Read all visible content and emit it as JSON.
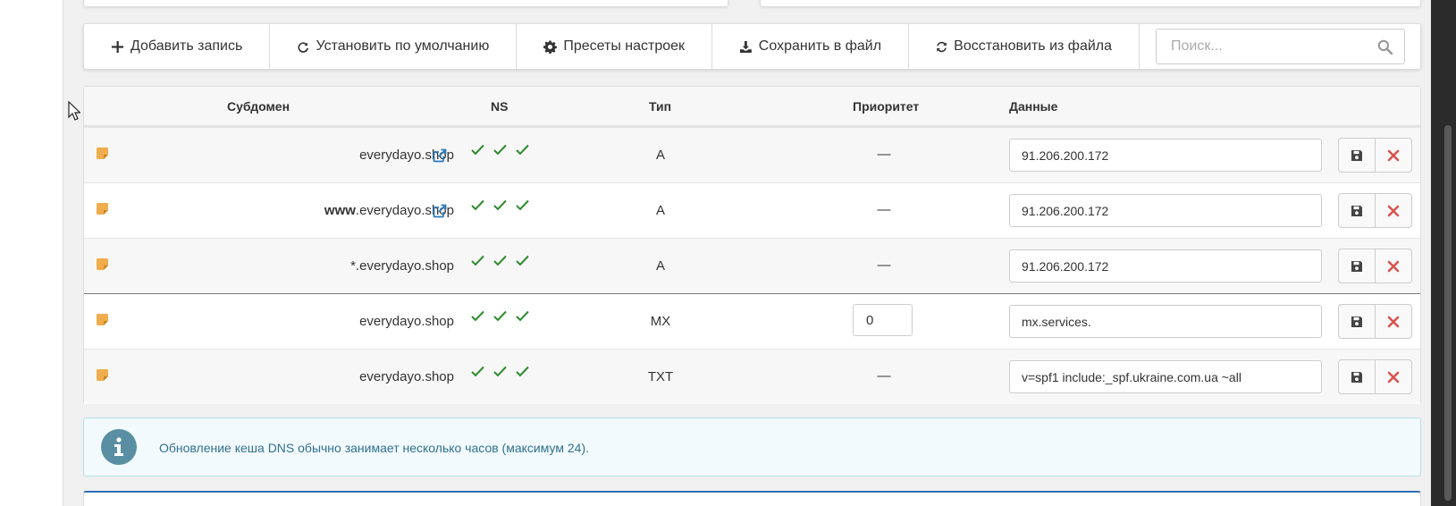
{
  "toolbar": {
    "add_label": "Добавить запись",
    "reset_label": "Установить по умолчанию",
    "presets_label": "Пресеты настроек",
    "save_file_label": "Сохранить в файл",
    "restore_file_label": "Восстановить из файла",
    "search_placeholder": "Поиск..."
  },
  "table": {
    "headers": {
      "subdomain": "Субдомен",
      "ns": "NS",
      "type": "Тип",
      "priority": "Приоритет",
      "data": "Данные"
    },
    "rows": [
      {
        "subdomain_prefix": "",
        "subdomain": "everydayo.shop",
        "type": "A",
        "priority": "—",
        "data": "91.206.200.172"
      },
      {
        "subdomain_prefix": "www",
        "subdomain": ".everydayo.shop",
        "type": "A",
        "priority": "—",
        "data": "91.206.200.172"
      },
      {
        "subdomain_prefix": "",
        "subdomain": "*.everydayo.shop",
        "type": "A",
        "priority": "—",
        "data": "91.206.200.172"
      },
      {
        "subdomain_prefix": "",
        "subdomain": "everydayo.shop",
        "type": "MX",
        "priority": "0",
        "data": "mx.services."
      },
      {
        "subdomain_prefix": "",
        "subdomain": "everydayo.shop",
        "type": "TXT",
        "priority": "—",
        "data": "v=spf1 include:_spf.ukraine.com.ua ~all"
      }
    ]
  },
  "alert": {
    "text": "Обновление кеша DNS обычно занимает несколько часов (максимум 24)."
  },
  "colors": {
    "check": "#2e8b2e",
    "delete": "#d9534f",
    "note": "#f0ad4e",
    "link": "#2a7bbd",
    "info": "#31708f"
  }
}
